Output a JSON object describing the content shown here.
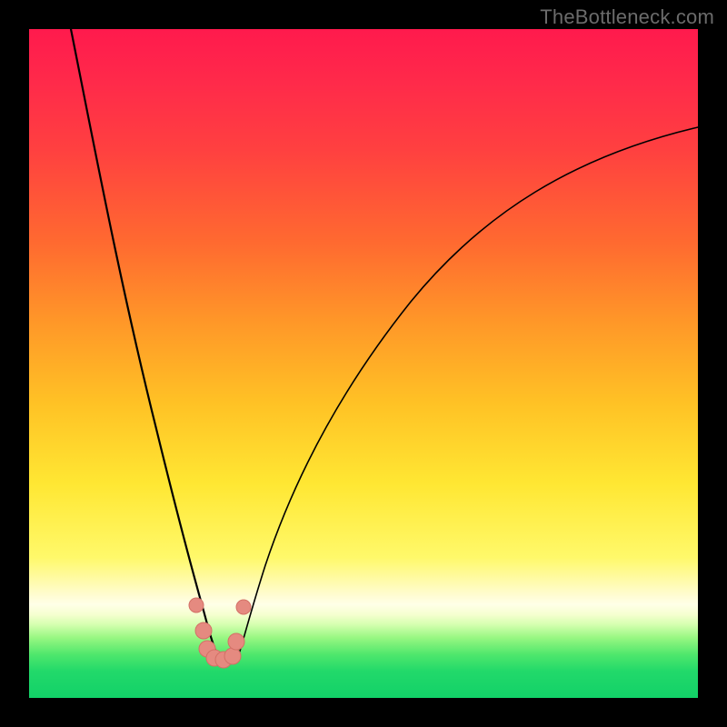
{
  "watermark": "TheBottleneck.com",
  "colors": {
    "frame": "#000000",
    "curve": "#000000",
    "marker_fill": "#e58a80",
    "marker_stroke": "#d37066",
    "gradient_top": "#ff1a4d",
    "gradient_bottom": "#12d168"
  },
  "chart_data": {
    "type": "line",
    "title": "",
    "xlabel": "",
    "ylabel": "",
    "xlim": [
      0,
      100
    ],
    "ylim": [
      0,
      100
    ],
    "grid": false,
    "legend": false,
    "notes": "Two smooth black curves descending into a V-shaped minimum near x≈26, over a vertical red→orange→yellow→green gradient. Salmon markers cluster at the bottom of the V.",
    "series": [
      {
        "name": "left_curve",
        "x": [
          10,
          12,
          14,
          16,
          18,
          20,
          22,
          24,
          25,
          26
        ],
        "y": [
          100,
          86,
          72,
          58,
          44,
          31,
          20,
          10,
          5,
          2
        ]
      },
      {
        "name": "right_curve",
        "x": [
          30,
          32,
          35,
          40,
          46,
          54,
          64,
          76,
          88,
          100
        ],
        "y": [
          2,
          9,
          19,
          33,
          46,
          58,
          68,
          76,
          81,
          84
        ]
      },
      {
        "name": "valley_markers",
        "type": "scatter",
        "x": [
          23.5,
          24.8,
          25.3,
          26.4,
          27.6,
          28.6,
          29.0,
          30.3
        ],
        "y": [
          8.5,
          3.8,
          1.8,
          1.5,
          1.5,
          1.9,
          3.6,
          8.8
        ]
      }
    ]
  }
}
